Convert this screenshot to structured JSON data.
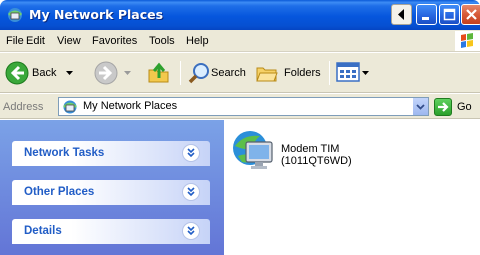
{
  "window": {
    "title": "My Network Places",
    "icon": "network-places-icon",
    "controls": [
      "back-arrow-button",
      "minimize-button",
      "maximize-button",
      "close-button"
    ]
  },
  "menu": {
    "items": [
      "File",
      "Edit",
      "View",
      "Favorites",
      "Tools",
      "Help"
    ]
  },
  "toolbar": {
    "back_label": "Back",
    "search_label": "Search",
    "folders_label": "Folders"
  },
  "address": {
    "label": "Address",
    "value": "My Network Places",
    "go_label": "Go"
  },
  "left_panel": {
    "sections": [
      {
        "title": "Network Tasks"
      },
      {
        "title": "Other Places"
      },
      {
        "title": "Details"
      }
    ]
  },
  "items": [
    {
      "name_line1": "Modem TIM",
      "name_line2": "(1011QT6WD)",
      "icon": "network-computer-icon"
    }
  ],
  "colors": {
    "titlebar_blue": "#0656dd",
    "panel_blue": "#7ba2e7",
    "task_title_blue": "#215dc6",
    "close_red": "#d75a38"
  }
}
